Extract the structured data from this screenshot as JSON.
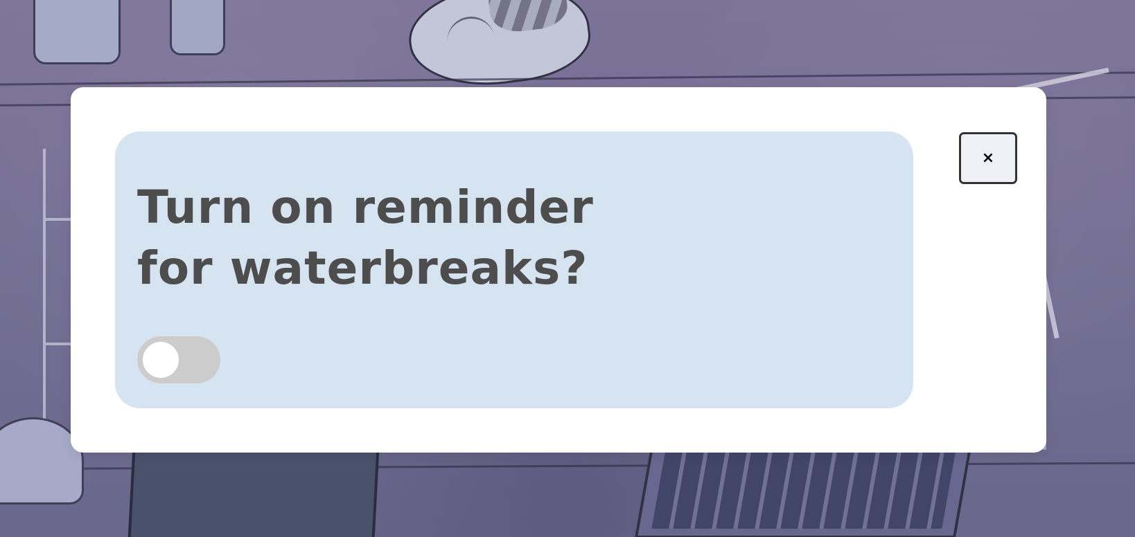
{
  "modal": {
    "reminder_prompt": "Turn on reminder for waterbreaks?",
    "toggle_state": "off",
    "close_button": {
      "icon": "×"
    }
  },
  "colors": {
    "modal_background": "#ffffff",
    "card_background": "#d6e4f1",
    "text": "#4d4d4d",
    "toggle_track": "#cccccc",
    "toggle_knob": "#ffffff",
    "close_button_background": "#eef2f7",
    "close_button_border": "#333333"
  },
  "icons": {
    "close": "close-icon"
  }
}
